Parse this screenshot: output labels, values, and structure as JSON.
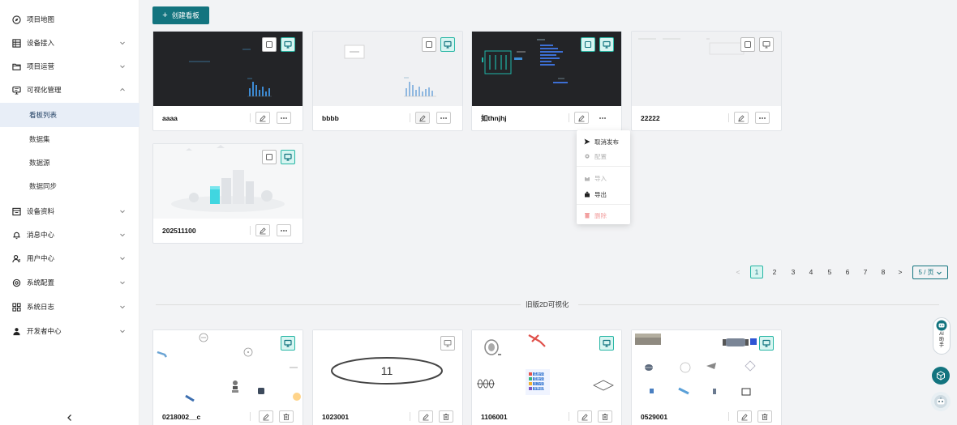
{
  "sidebar": {
    "items": [
      {
        "label": "项目地图",
        "icon": "map-icon"
      },
      {
        "label": "设备接入",
        "icon": "device-access-icon"
      },
      {
        "label": "项目运营",
        "icon": "folder-icon"
      },
      {
        "label": "可视化管理",
        "icon": "monitor-icon"
      },
      {
        "label": "看板列表"
      },
      {
        "label": "数据集"
      },
      {
        "label": "数据源"
      },
      {
        "label": "数据同步"
      },
      {
        "label": "设备资料",
        "icon": "doc-icon"
      },
      {
        "label": "消息中心",
        "icon": "bell-icon"
      },
      {
        "label": "用户中心",
        "icon": "users-icon"
      },
      {
        "label": "系统配置",
        "icon": "settings-icon"
      },
      {
        "label": "系统日志",
        "icon": "log-icon"
      },
      {
        "label": "开发者中心",
        "icon": "developer-icon"
      }
    ],
    "collapse": "<"
  },
  "toolbar": {
    "create_label": "创建看板",
    "plus": "+"
  },
  "boards": [
    {
      "name": "aaaa"
    },
    {
      "name": "bbbb"
    },
    {
      "name": "如thnjhj"
    },
    {
      "name": "22222"
    },
    {
      "name": "202511100"
    }
  ],
  "dropdown": {
    "items": [
      {
        "label": "取消发布",
        "state": "normal"
      },
      {
        "label": "配置",
        "state": "disabled"
      },
      {
        "label": "导入",
        "state": "disabled"
      },
      {
        "label": "导出",
        "state": "normal"
      },
      {
        "label": "删除",
        "state": "danger"
      }
    ]
  },
  "pagination": {
    "prev": "<",
    "pages": [
      "1",
      "2",
      "3",
      "4",
      "5",
      "6",
      "7",
      "8"
    ],
    "current": "1",
    "next": ">",
    "page_size": "5 / 页"
  },
  "legacy": {
    "title": "旧版2D可视化",
    "boards": [
      {
        "name": "0218002__c"
      },
      {
        "name": "1023001"
      },
      {
        "name": "1106001"
      },
      {
        "name": "0529001"
      }
    ],
    "ellipse_text": "11",
    "legend_items": [
      "温度传感",
      "湿度传感",
      "压力传感",
      "报警装置"
    ]
  },
  "float": {
    "ai_label": "AI\n助\n手"
  },
  "colors": {
    "primary": "#13747f",
    "badge_green": "#27b6a4",
    "active_bg": "#e8eef7"
  }
}
